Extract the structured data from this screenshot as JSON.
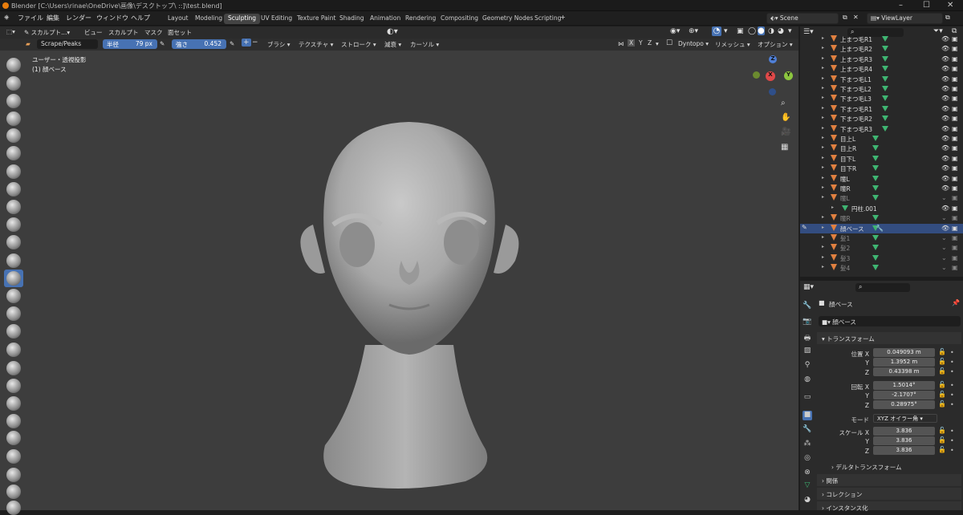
{
  "window": {
    "title": "Blender [C:\\Users\\rinae\\OneDrive\\画像\\デスクトップ\\ ::]\\test.blend]"
  },
  "menu": {
    "items": [
      "ファイル",
      "編集",
      "レンダー",
      "ウィンドウ",
      "ヘルプ"
    ]
  },
  "workspaces": [
    "Layout",
    "Modeling",
    "Sculpting",
    "UV Editing",
    "Texture Paint",
    "Shading",
    "Animation",
    "Rendering",
    "Compositing",
    "Geometry Nodes",
    "Scripting"
  ],
  "active_workspace": "Sculpting",
  "scene": {
    "label": "Scene",
    "viewlayer": "ViewLayer"
  },
  "viewport_header": {
    "mode": "スカルプト...",
    "items": [
      "ビュー",
      "スカルプト",
      "マスク",
      "面セット"
    ]
  },
  "tool_settings": {
    "brush": "Scrape/Peaks",
    "radius_label": "半径",
    "radius_value": "79 px",
    "strength_label": "強さ",
    "strength_value": "0.452",
    "menus": [
      "ブラシ",
      "テクスチャ",
      "ストローク",
      "減衰",
      "カーソル"
    ],
    "axes": [
      "X",
      "Y",
      "Z"
    ],
    "dyntopo": "Dyntopo",
    "remesh": "リメッシュ",
    "options": "オプション"
  },
  "overlay_text": {
    "view": "ユーザー・透視投影",
    "object": "(1) 顔ベース"
  },
  "outliner": {
    "rows": [
      {
        "name": "上まつ毛R1",
        "dim": false
      },
      {
        "name": "上まつ毛R2",
        "dim": false
      },
      {
        "name": "上まつ毛R3",
        "dim": false
      },
      {
        "name": "上まつ毛R4",
        "dim": false
      },
      {
        "name": "下まつ毛L1",
        "dim": false
      },
      {
        "name": "下まつ毛L2",
        "dim": false
      },
      {
        "name": "下まつ毛L3",
        "dim": false
      },
      {
        "name": "下まつ毛R1",
        "dim": false
      },
      {
        "name": "下まつ毛R2",
        "dim": false
      },
      {
        "name": "下まつ毛R3",
        "dim": false
      },
      {
        "name": "目上L",
        "dim": false
      },
      {
        "name": "目上R",
        "dim": false
      },
      {
        "name": "目下L",
        "dim": false
      },
      {
        "name": "目下R",
        "dim": false
      },
      {
        "name": "瞳L",
        "dim": false
      },
      {
        "name": "瞳R",
        "dim": false
      },
      {
        "name": "瞳L",
        "dim": true
      },
      {
        "name": "円柱.001",
        "dim": false
      },
      {
        "name": "瞳R",
        "dim": true
      },
      {
        "name": "顔ベース",
        "dim": false,
        "selected": true
      },
      {
        "name": "髪1",
        "dim": true
      },
      {
        "name": "髪2",
        "dim": true
      },
      {
        "name": "髪3",
        "dim": true
      },
      {
        "name": "髪4",
        "dim": true
      }
    ]
  },
  "properties": {
    "object_name": "顔ベース",
    "data_name": "顔ベース",
    "sections": {
      "transform": "トランスフォーム",
      "delta": "デルタトランスフォーム",
      "relations": "関係",
      "collections": "コレクション",
      "instancing": "インスタンス化"
    },
    "location": {
      "label": "位置 X",
      "x": "0.049093 m",
      "y": "1.3952 m",
      "z": "0.43398 m"
    },
    "rotation": {
      "label": "回転 X",
      "x": "1.5014°",
      "y": "-2.1707°",
      "z": "0.28975°"
    },
    "mode": {
      "label": "モード",
      "value": "XYZ オイラー角"
    },
    "scale": {
      "label": "スケール X",
      "x": "3.836",
      "y": "3.836",
      "z": "3.836"
    },
    "axis_labels": {
      "y": "Y",
      "z": "Z"
    }
  },
  "colors": {
    "accent": "#4772b3",
    "selected_row": "#334d80",
    "object_orange": "#e08040",
    "mesh_green": "#3fb572"
  }
}
